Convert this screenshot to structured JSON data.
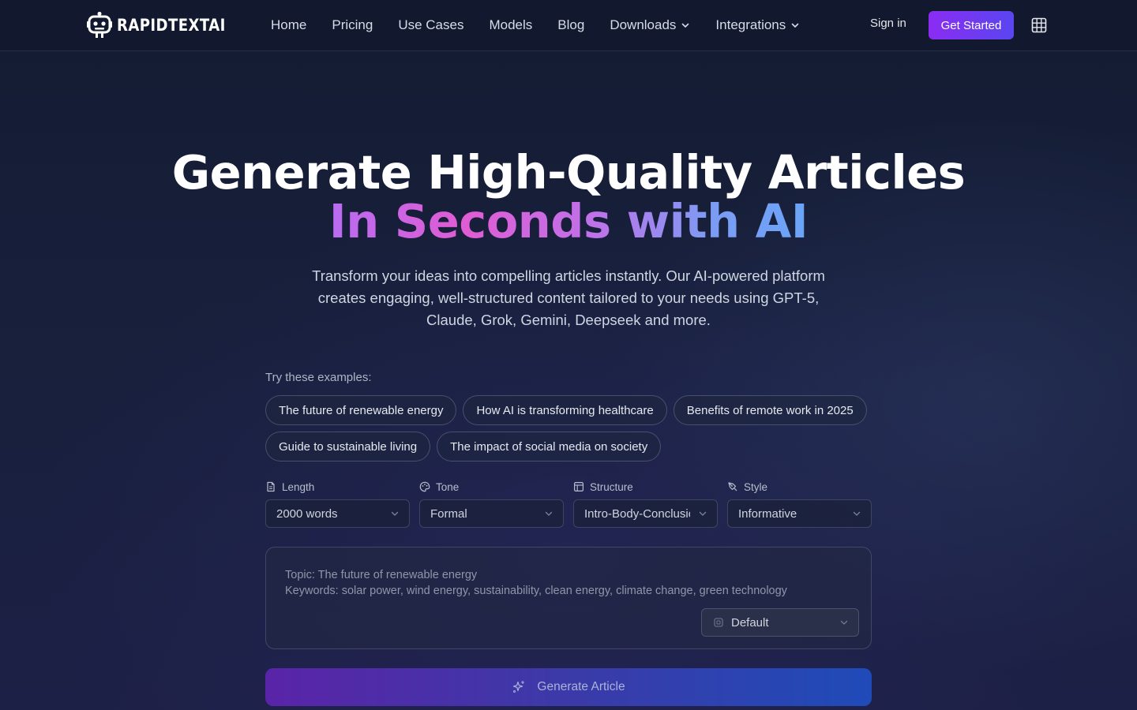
{
  "nav": {
    "brand": "RAPIDTEXTAI",
    "links": [
      {
        "label": "Home"
      },
      {
        "label": "Pricing"
      },
      {
        "label": "Use Cases"
      },
      {
        "label": "Models"
      },
      {
        "label": "Blog"
      },
      {
        "label": "Downloads",
        "dropdown": true
      },
      {
        "label": "Integrations",
        "dropdown": true
      }
    ],
    "sign_in": "Sign in",
    "get_started": "Get Started",
    "language_icon": "language-grid-icon"
  },
  "hero": {
    "title_line1": "Generate High-Quality Articles",
    "title_line2": "In Seconds with AI",
    "subtitle": "Transform your ideas into compelling articles instantly. Our AI-powered platform creates engaging, well-structured content tailored to your needs using GPT-5, Claude, Grok, Gemini, Deepseek and more."
  },
  "examples": {
    "label": "Try these examples:",
    "items": [
      "The future of renewable energy",
      "How AI is transforming healthcare",
      "Benefits of remote work in 2025",
      "Guide to sustainable living",
      "The impact of social media on society"
    ]
  },
  "options": {
    "length": {
      "label": "Length",
      "value": "2000 words",
      "icon": "document-icon"
    },
    "tone": {
      "label": "Tone",
      "value": "Formal",
      "icon": "palette-icon"
    },
    "structure": {
      "label": "Structure",
      "value": "Intro-Body-Conclusion",
      "icon": "layout-icon"
    },
    "style": {
      "label": "Style",
      "value": "Informative",
      "icon": "pen-tool-icon"
    }
  },
  "prompt": {
    "topic_line": "Topic: The future of renewable energy",
    "keywords_line": "Keywords: solar power, wind energy, sustainability, clean energy, climate change, green technology",
    "model_value": "Default"
  },
  "generate": {
    "label": "Generate Article"
  },
  "colors": {
    "accent_start": "#8a2cf2",
    "accent_end": "#5a46f0",
    "background": "#18203d",
    "gradient_pink": "#e05cd3",
    "gradient_blue": "#6aa4f7"
  }
}
